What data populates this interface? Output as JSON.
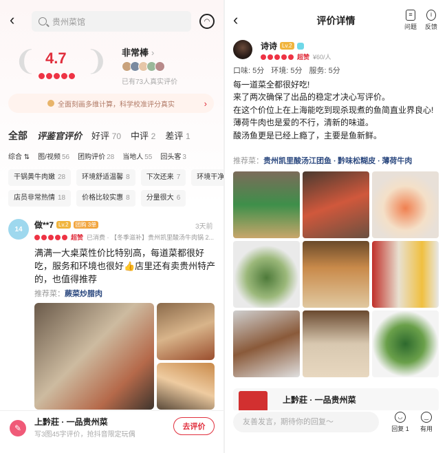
{
  "left": {
    "search_placeholder": "贵州菜馆",
    "score": "4.7",
    "verdict": "非常棒",
    "verdict_chevron": "›",
    "real_count": "已有73人真实评价",
    "banner": "全面刻画多维计算，科学校准评分真实",
    "banner_chevron": "›",
    "tabs": [
      {
        "label": "全部",
        "count": ""
      },
      {
        "label": "评鉴官评价",
        "count": ""
      },
      {
        "label": "好评",
        "count": "70"
      },
      {
        "label": "中评",
        "count": "2"
      },
      {
        "label": "差评",
        "count": "1"
      }
    ],
    "subtabs": [
      {
        "label": "综合 ⇅",
        "count": ""
      },
      {
        "label": "图/视频",
        "count": "56"
      },
      {
        "label": "团购评价",
        "count": "28"
      },
      {
        "label": "当地人",
        "count": "55"
      },
      {
        "label": "回头客",
        "count": "3"
      }
    ],
    "chips_row1": [
      {
        "label": "干锅黄牛肉嫩",
        "count": "28"
      },
      {
        "label": "环境舒适温馨",
        "count": "8"
      },
      {
        "label": "下次还来",
        "count": "7"
      },
      {
        "label": "环境干净",
        "count": ""
      }
    ],
    "chips_row2": [
      {
        "label": "店员非常热情",
        "count": "18"
      },
      {
        "label": "价格比较实惠",
        "count": "8"
      },
      {
        "label": "分量很大",
        "count": "6"
      }
    ],
    "review": {
      "avatar_text": "14",
      "name": "做**7",
      "level": "Lv.2",
      "team": "团购 3单",
      "time": "3天前",
      "super": "超赞",
      "consumed": "已消费 · 【冬季滋补】贵州凯里酸汤牛肉锅 2...",
      "text": "满满一大桌菜性价比特别高，每道菜都很好吃，服务和环境也很好👍店里还有卖贵州特产的，也值得推荐",
      "rec_label": "推荐菜：",
      "rec_dish": "蕨菜炒腊肉"
    },
    "shop_name": "上黔莊 · 一品贵州菜",
    "shop_hint": "写3图45字评价，抢抖音限定玩偶",
    "go_review": "去评价",
    "icons": {
      "back": "‹",
      "chat": "◠"
    }
  },
  "right": {
    "title": "评价详情",
    "back": "‹",
    "issue_label": "问题",
    "feedback_label": "反馈",
    "reviewer": {
      "name": "诗诗",
      "level": "Lv.2",
      "super": "超赞",
      "price": "¥60/人"
    },
    "sub_scores": [
      "口味: 5分",
      "环境: 5分",
      "服务: 5分"
    ],
    "body": [
      "每一道菜全都很好吃!",
      "来了两次确保了出品的稳定才决心写评价。",
      "在这个价位上在上海能吃到现杀现煮的鱼简直业界良心!",
      "薄荷牛肉也是爱的不行，清新的味道。",
      "酸汤鱼更是已经上瘾了，主要是鱼新鲜。"
    ],
    "rec_label": "推荐菜：",
    "rec_dishes": "贵州凯里酸汤江团鱼 · 黔味松糊皮 · 薄荷牛肉",
    "store_name": "上黔莊 · 一品贵州菜",
    "comment_placeholder": "友善发言，期待你的回复～",
    "reply_label": "回复 1",
    "useful_label": "有用"
  },
  "colors": {
    "accent": "#e02e3c",
    "dish_blue": "#2d4a80",
    "badge": "#f0b43c"
  }
}
